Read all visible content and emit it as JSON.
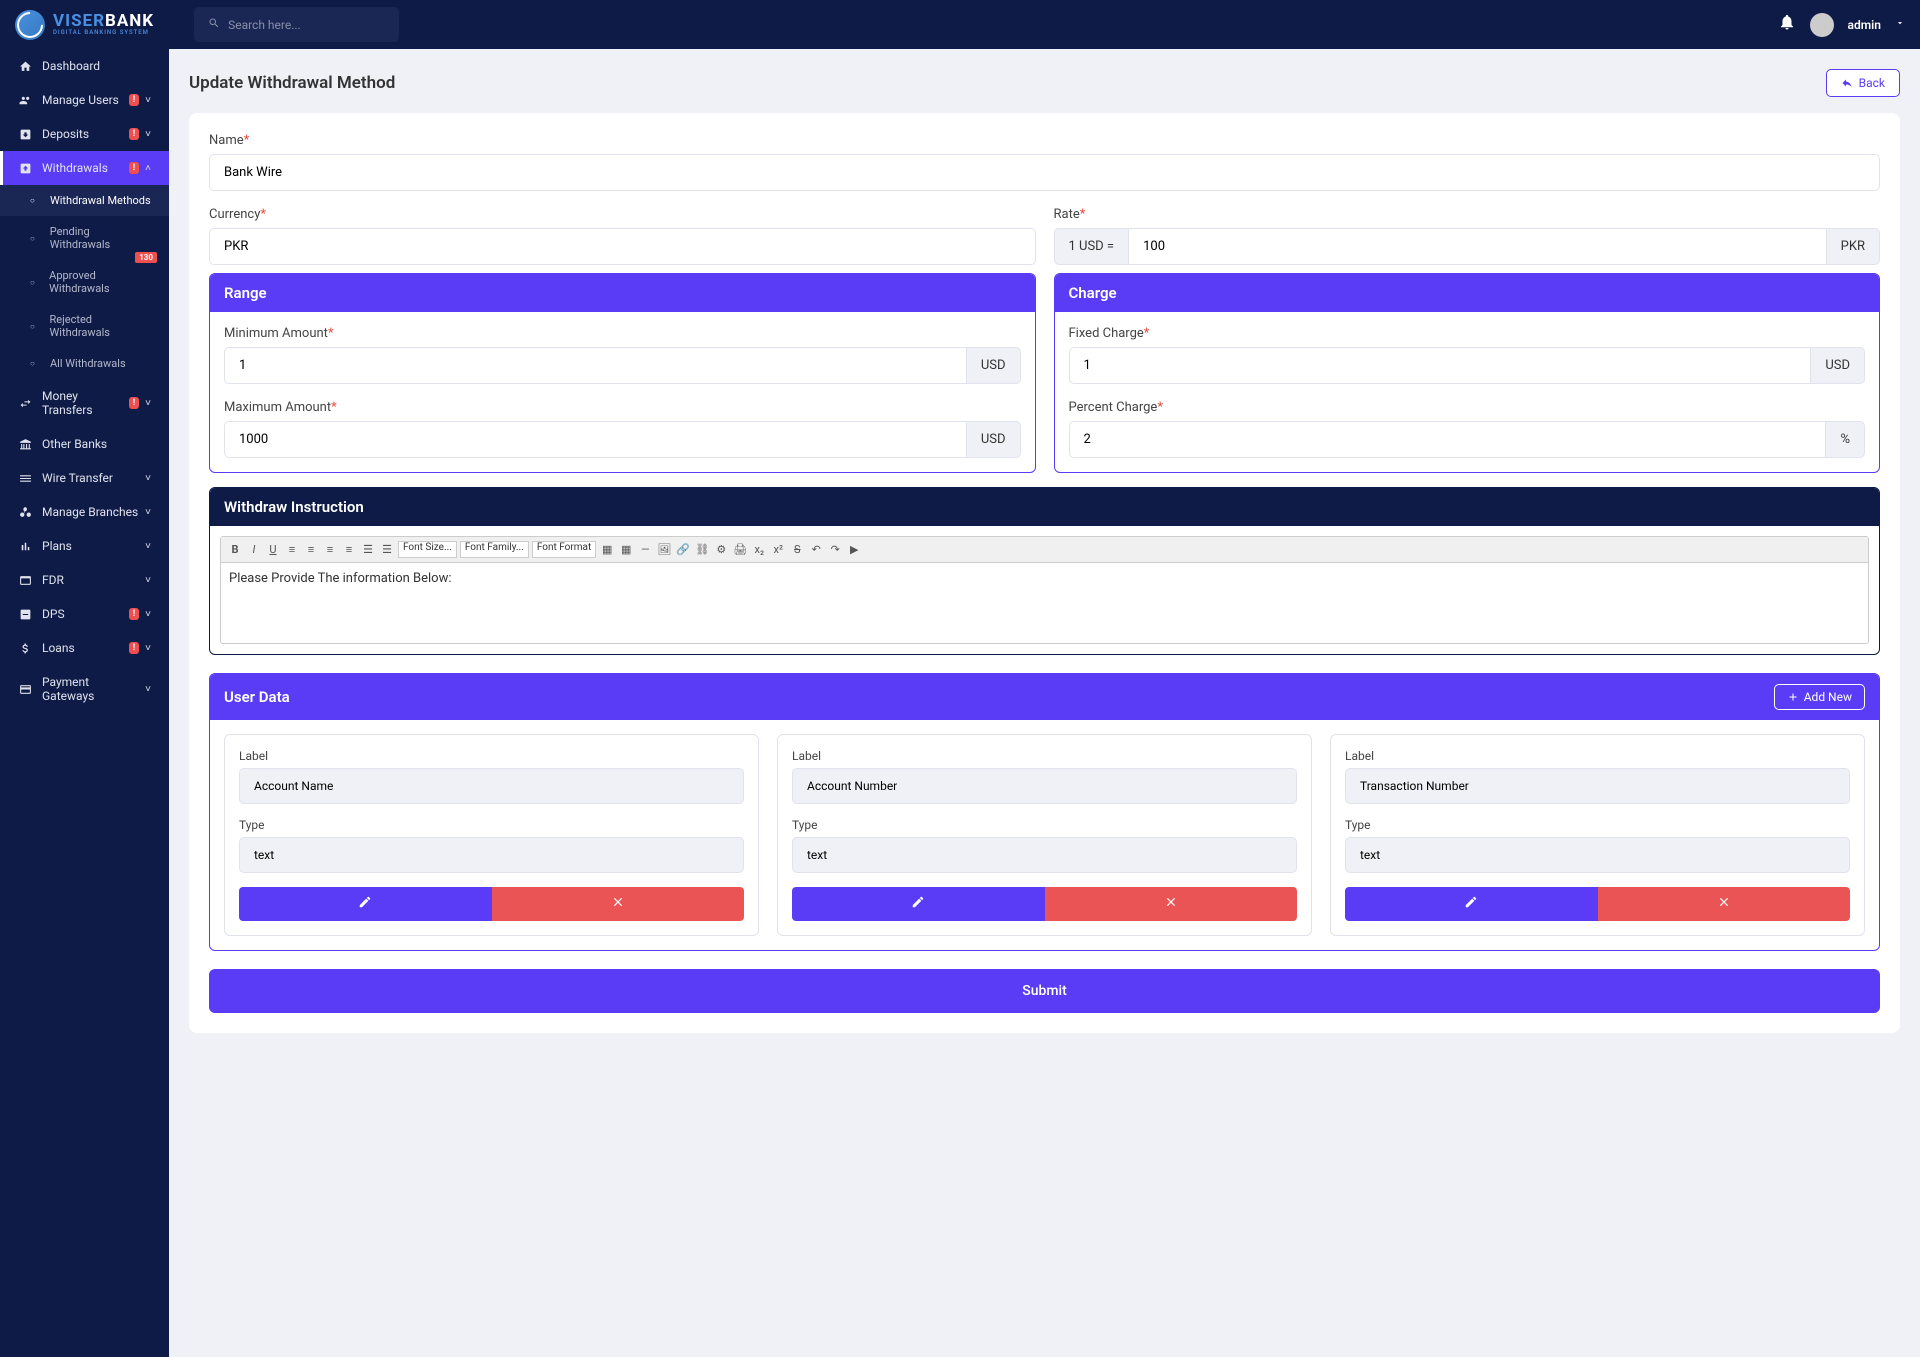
{
  "header": {
    "logo_main": "VISER",
    "logo_main2": "BANK",
    "logo_sub": "DIGITAL BANKING SYSTEM",
    "search_placeholder": "Search here...",
    "admin": "admin"
  },
  "sidebar": {
    "items": [
      {
        "icon": "home",
        "label": "Dashboard",
        "badge": "",
        "chevron": false
      },
      {
        "icon": "users",
        "label": "Manage Users",
        "badge": "!",
        "chevron": true
      },
      {
        "icon": "deposit",
        "label": "Deposits",
        "badge": "!",
        "chevron": true
      },
      {
        "icon": "withdraw",
        "label": "Withdrawals",
        "badge": "!",
        "chevron": true,
        "active": true,
        "sub": [
          {
            "label": "Withdrawal Methods",
            "active": true
          },
          {
            "label": "Pending Withdrawals",
            "badge": "130"
          },
          {
            "label": "Approved Withdrawals"
          },
          {
            "label": "Rejected Withdrawals"
          },
          {
            "label": "All Withdrawals"
          }
        ]
      },
      {
        "icon": "transfer",
        "label": "Money Transfers",
        "badge": "!",
        "chevron": true
      },
      {
        "icon": "bank",
        "label": "Other Banks",
        "badge": "",
        "chevron": false
      },
      {
        "icon": "wire",
        "label": "Wire Transfer",
        "badge": "",
        "chevron": true
      },
      {
        "icon": "branch",
        "label": "Manage Branches",
        "badge": "",
        "chevron": true
      },
      {
        "icon": "plans",
        "label": "Plans",
        "badge": "",
        "chevron": true
      },
      {
        "icon": "fdr",
        "label": "FDR",
        "badge": "",
        "chevron": true
      },
      {
        "icon": "dps",
        "label": "DPS",
        "badge": "!",
        "chevron": true
      },
      {
        "icon": "loans",
        "label": "Loans",
        "badge": "!",
        "chevron": true
      },
      {
        "icon": "card",
        "label": "Payment Gateways",
        "badge": "",
        "chevron": true
      }
    ]
  },
  "page": {
    "title": "Update Withdrawal Method",
    "back": "Back",
    "name_label": "Name",
    "name_value": "Bank Wire",
    "currency_label": "Currency",
    "currency_value": "PKR",
    "rate_label": "Rate",
    "rate_prefix": "1 USD =",
    "rate_value": "100",
    "rate_suffix": "PKR",
    "range_title": "Range",
    "min_label": "Minimum Amount",
    "min_value": "1",
    "max_label": "Maximum Amount",
    "max_value": "1000",
    "usd": "USD",
    "charge_title": "Charge",
    "fixed_label": "Fixed Charge",
    "fixed_value": "1",
    "percent_label": "Percent Charge",
    "percent_value": "2",
    "percent_suffix": "%",
    "instr_title": "Withdraw Instruction",
    "instr_content": "Please Provide The information Below:",
    "userdata_title": "User Data",
    "addnew": "Add New",
    "ud_label": "Label",
    "ud_type": "Type",
    "ud_items": [
      {
        "label": "Account Name",
        "type": "text"
      },
      {
        "label": "Account Number",
        "type": "text"
      },
      {
        "label": "Transaction Number",
        "type": "text"
      }
    ],
    "submit": "Submit",
    "font_size": "Font Size...",
    "font_family": "Font Family...",
    "font_format": "Font Format"
  }
}
